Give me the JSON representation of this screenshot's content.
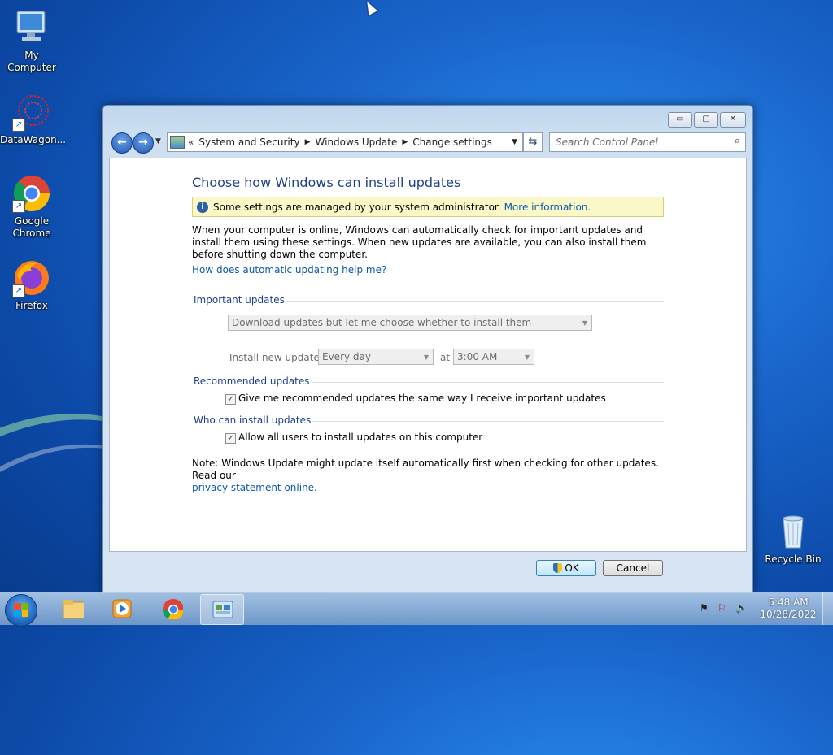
{
  "desktop": {
    "icons": [
      {
        "label": "My Computer"
      },
      {
        "label": "DataWagon..."
      },
      {
        "label": "Google Chrome"
      },
      {
        "label": "Firefox"
      },
      {
        "label": "Recycle Bin"
      }
    ]
  },
  "window": {
    "controls": {
      "minimize": "▭",
      "maximize": "▢",
      "close": "✕"
    },
    "address": {
      "prefix": "«",
      "segments": [
        "System and Security",
        "Windows Update",
        "Change settings"
      ],
      "separator": "▶"
    },
    "search_placeholder": "Search Control Panel",
    "title": "Choose how Windows can install updates",
    "infobar": {
      "text": "Some settings are managed by your system administrator.",
      "link": "More information."
    },
    "description": "When your computer is online, Windows can automatically check for important updates and install them using these settings. When new updates are available, you can also install them before shutting down the computer.",
    "help_link": "How does automatic updating help me?",
    "important": {
      "heading": "Important updates",
      "mode": "Download updates but let me choose whether to install them",
      "install_label": "Install new updates:",
      "day": "Every day",
      "at": "at",
      "time": "3:00 AM"
    },
    "recommended": {
      "heading": "Recommended updates",
      "checkbox": "Give me recommended updates the same way I receive important updates",
      "checked": true
    },
    "who": {
      "heading": "Who can install updates",
      "checkbox": "Allow all users to install updates on this computer",
      "checked": true
    },
    "note": {
      "text": "Note: Windows Update might update itself automatically first when checking for other updates.  Read our",
      "link": "privacy statement online",
      "end": "."
    },
    "buttons": {
      "ok": "OK",
      "cancel": "Cancel"
    }
  },
  "taskbar": {
    "items": [
      "windows-explorer",
      "media-player",
      "google-chrome",
      "control-panel"
    ],
    "clock": {
      "time": "5:48 AM",
      "date": "10/28/2022"
    }
  }
}
